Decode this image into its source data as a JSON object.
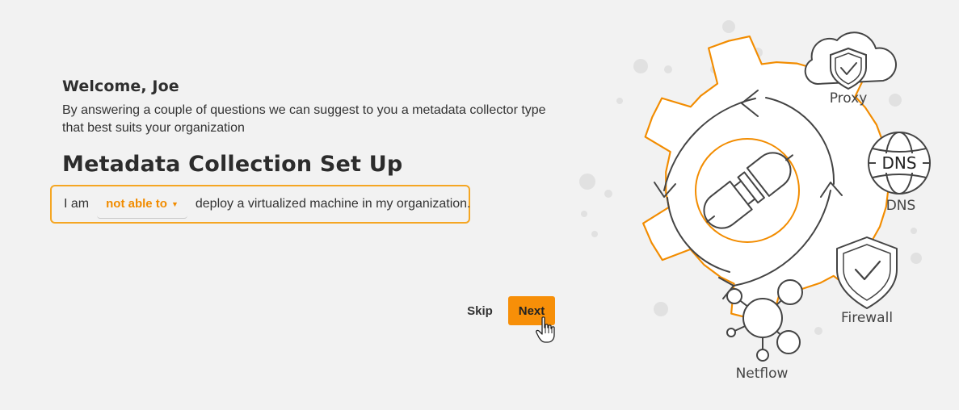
{
  "welcome": {
    "greeting": "Welcome,",
    "user_name": "Joe"
  },
  "intro": {
    "line1": "By answering a couple of questions we can suggest to you a metadata collector type",
    "line2": "that best suits your organization"
  },
  "page_title": "Metadata Collection Set Up",
  "sentence": {
    "prefix": "I am",
    "selected_option": "not able to",
    "suffix": "deploy a virtualized machine in my organization."
  },
  "actions": {
    "skip_label": "Skip",
    "next_label": "Next"
  },
  "illustration": {
    "labels": {
      "proxy": "Proxy",
      "dns_badge": "DNS",
      "dns": "DNS",
      "firewall": "Firewall",
      "netflow": "Netflow"
    }
  },
  "colors": {
    "accent": "#f78f08",
    "accent_text": "#f18c00",
    "background": "#f2f2f2",
    "border_highlight": "#f5a623"
  }
}
